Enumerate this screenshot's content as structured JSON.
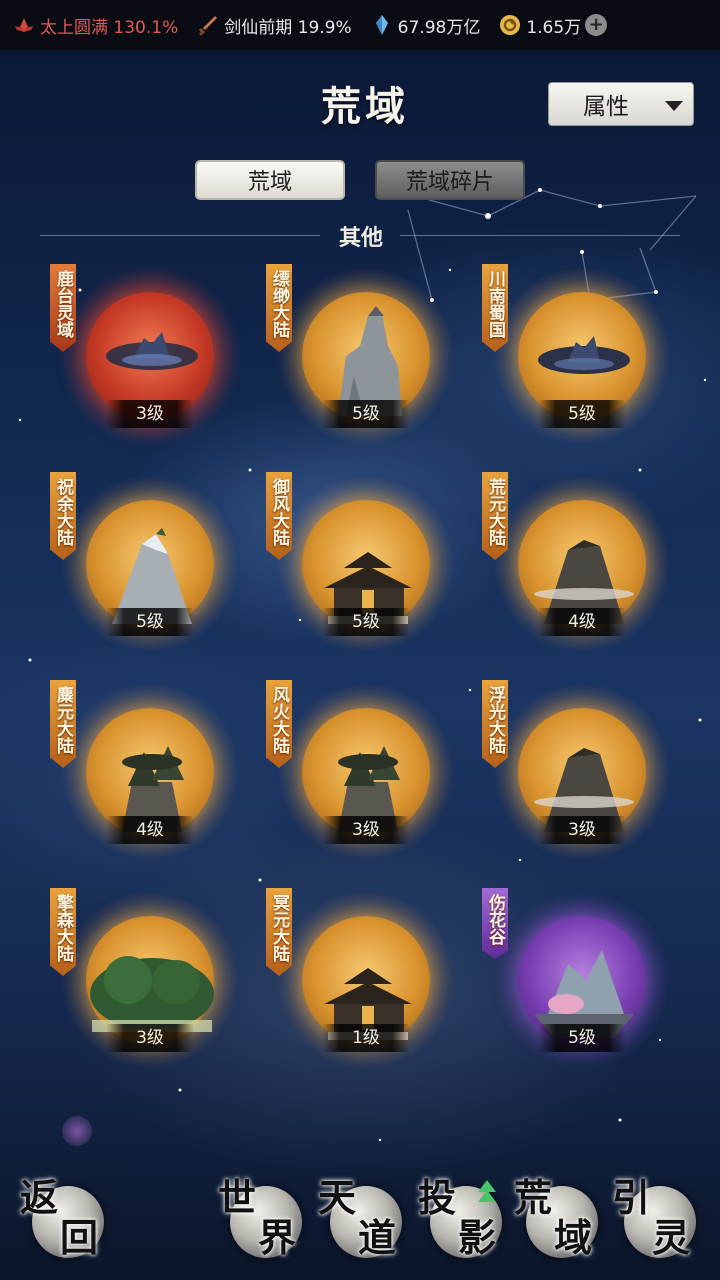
{
  "status_bar": {
    "realm_stat": "太上圆满 130.1%",
    "sword_stat": "剑仙前期 19.9%",
    "spirit_stones": "67.98万亿",
    "currency": "1.65万",
    "plus": "+"
  },
  "header": {
    "title": "荒域",
    "dropdown_label": "属性"
  },
  "tabs": {
    "active": "荒域",
    "inactive": "荒域碎片"
  },
  "section": {
    "label": "其他"
  },
  "realms": [
    {
      "name": "鹿台灵域",
      "level": "3级",
      "color": "red"
    },
    {
      "name": "缥缈大陆",
      "level": "5级",
      "color": "gold"
    },
    {
      "name": "川南蜀国",
      "level": "5级",
      "color": "gold"
    },
    {
      "name": "祝余大陆",
      "level": "5级",
      "color": "gold"
    },
    {
      "name": "御风大陆",
      "level": "5级",
      "color": "gold"
    },
    {
      "name": "荒元大陆",
      "level": "4级",
      "color": "gold"
    },
    {
      "name": "麋元大陆",
      "level": "4级",
      "color": "gold"
    },
    {
      "name": "风火大陆",
      "level": "3级",
      "color": "gold"
    },
    {
      "name": "浮光大陆",
      "level": "3级",
      "color": "gold"
    },
    {
      "name": "擎森大陆",
      "level": "3级",
      "color": "gold"
    },
    {
      "name": "冥元大陆",
      "level": "1级",
      "color": "gold"
    },
    {
      "name": "伤花谷",
      "level": "5级",
      "color": "purple"
    }
  ],
  "bottom_nav": {
    "back": [
      "返",
      "回"
    ],
    "world": [
      "世",
      "界"
    ],
    "heaven_dao": [
      "天",
      "道"
    ],
    "projection": [
      "投",
      "影"
    ],
    "wild_domain": [
      "荒",
      "域"
    ],
    "guide_spirit": [
      "引",
      "灵"
    ]
  },
  "colors": {
    "status_red": "#e25a52",
    "gold_glow": "#f0b04a",
    "upgrade_arrow": "#49c46b"
  }
}
